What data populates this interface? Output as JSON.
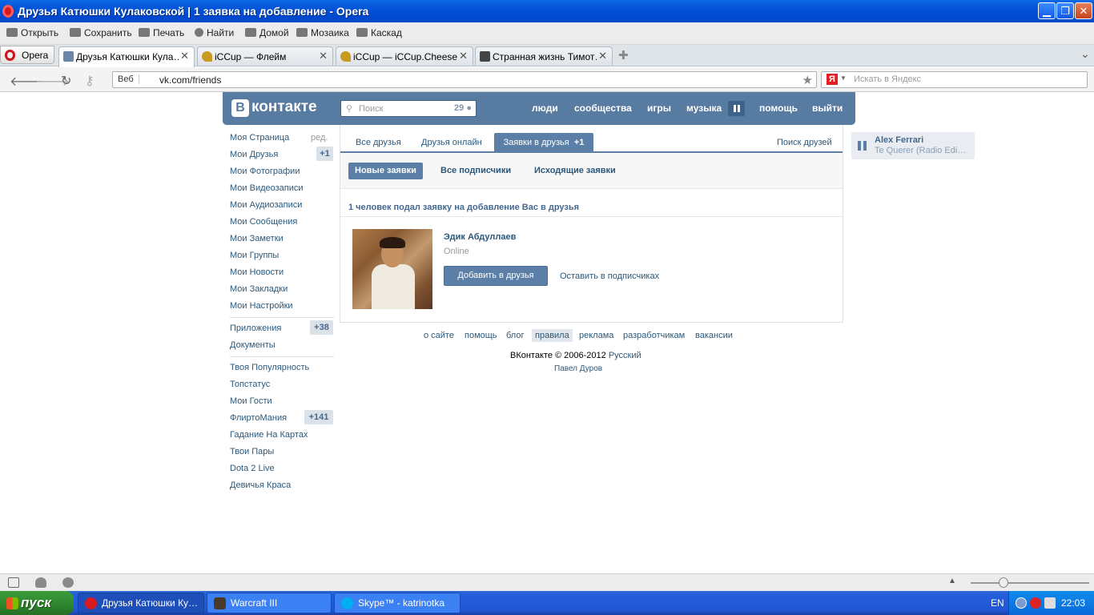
{
  "window": {
    "title": "Друзья Катюшки Кулаковской | 1 заявка на добавление - Opera",
    "minimize": "▁",
    "maximize": "❐",
    "close": "✕"
  },
  "toolbar": [
    {
      "label": "Открыть",
      "icon": "folder-icon"
    },
    {
      "label": "Сохранить",
      "icon": "save-icon"
    },
    {
      "label": "Печать",
      "icon": "printer-icon"
    },
    {
      "label": "Найти",
      "icon": "search-icon"
    },
    {
      "label": "Домой",
      "icon": "home-icon"
    },
    {
      "label": "Мозаика",
      "icon": "tile-icon"
    },
    {
      "label": "Каскад",
      "icon": "cascade-icon"
    }
  ],
  "tabs": {
    "opera_menu": "Opera",
    "items": [
      {
        "label": "Друзья Катюшки Кула…",
        "active": true
      },
      {
        "label": "iCCup — Флейм",
        "active": false
      },
      {
        "label": "iCCup — iCCup.Cheese",
        "active": false
      },
      {
        "label": "Странная жизнь Тимот…",
        "active": false
      }
    ],
    "close_glyph": "✕",
    "new_tab": "✚",
    "menu_glyph": "⌄"
  },
  "address": {
    "back": "🡐",
    "forward": "🡒",
    "reload": "↻",
    "key": "⚷",
    "web_label": "Веб",
    "url": "vk.com/friends",
    "bookmark": "★",
    "search_engine_letter": "Я",
    "search_placeholder": "Искать в Яндекс"
  },
  "vk_header": {
    "logo_letter": "В",
    "logo_text": "контакте",
    "search_placeholder": "Поиск",
    "search_count": "29",
    "nav": [
      "люди",
      "сообщества",
      "игры",
      "музыка",
      "помощь",
      "выйти"
    ]
  },
  "left_menu": {
    "edit": "ред.",
    "group1": [
      {
        "label": "Моя Страница"
      },
      {
        "label": "Мои Друзья",
        "badge": "+1"
      },
      {
        "label": "Мои Фотографии"
      },
      {
        "label": "Мои Видеозаписи"
      },
      {
        "label": "Мои Аудиозаписи"
      },
      {
        "label": "Мои Сообщения"
      },
      {
        "label": "Мои Заметки"
      },
      {
        "label": "Мои Группы"
      },
      {
        "label": "Мои Новости"
      },
      {
        "label": "Мои Закладки"
      },
      {
        "label": "Мои Настройки"
      }
    ],
    "group2": [
      {
        "label": "Приложения",
        "badge": "+38"
      },
      {
        "label": "Документы"
      }
    ],
    "group3": [
      {
        "label": "Твоя Популярность"
      },
      {
        "label": "Топстатус"
      },
      {
        "label": "Мои Гости"
      },
      {
        "label": "ФлиртоМания",
        "badge": "+141"
      },
      {
        "label": "Гадание На Картах"
      },
      {
        "label": "Твои Пары"
      },
      {
        "label": "Dota 2 Live"
      },
      {
        "label": "Девичья Краса"
      }
    ]
  },
  "friends": {
    "tab_all": "Все друзья",
    "tab_online": "Друзья онлайн",
    "tab_requests": "Заявки в друзья",
    "tab_requests_badge": "+1",
    "find_friends": "Поиск друзей",
    "sub_new": "Новые заявки",
    "sub_subscribers": "Все подписчики",
    "sub_outgoing": "Исходящие заявки",
    "requests_header": "1 человек подал заявку на добавление Вас в друзья",
    "request": {
      "name": "Эдик Абдуллаев",
      "status": "Online",
      "add_button": "Добавить в друзья",
      "keep_subscriber": "Оставить в подписчиках"
    }
  },
  "footer": {
    "links": [
      "о сайте",
      "помощь",
      "блог",
      "правила",
      "реклама",
      "разработчикам",
      "вакансии"
    ],
    "copyright": "ВКонтакте © 2006-2012",
    "language": "Русский",
    "founder": "Павел Дуров"
  },
  "player": {
    "artist": "Alex Ferrari",
    "song": "Te Querer (Radio Edi…"
  },
  "taskbar": {
    "start": "пуск",
    "tasks": [
      {
        "label": "Друзья Катюшки Ку…",
        "active": true
      },
      {
        "label": "Warcraft III",
        "active": false
      },
      {
        "label": "Skype™ - katrinotka",
        "active": false
      }
    ],
    "lang": "EN",
    "clock": "22:03"
  },
  "colors": {
    "vk_blue": "#587ba2",
    "vk_link": "#2b587a",
    "xp_blue": "#245edb",
    "xp_green": "#2f8a2f"
  }
}
